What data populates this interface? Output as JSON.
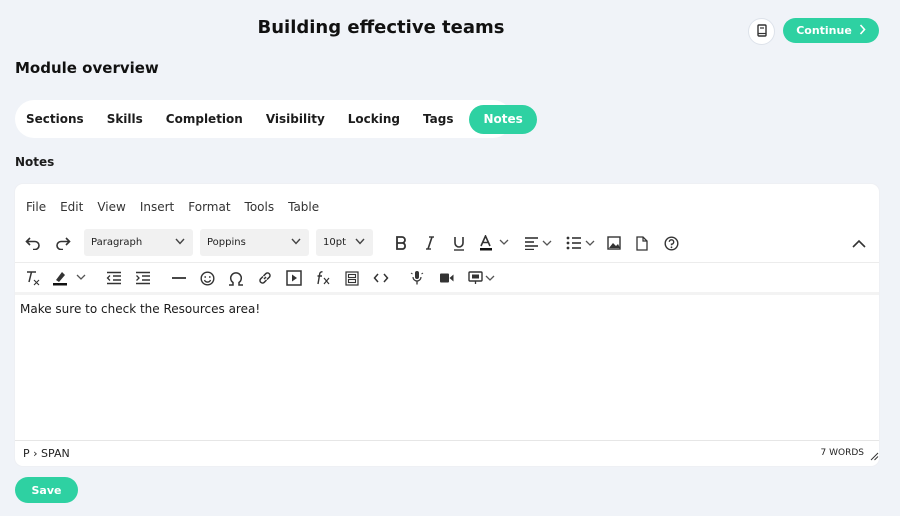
{
  "header": {
    "title": "Building effective teams",
    "book_icon": "book-icon",
    "continue_label": "Continue"
  },
  "module": {
    "title": "Module overview"
  },
  "tabs": [
    {
      "label": "Sections",
      "active": false
    },
    {
      "label": "Skills",
      "active": false
    },
    {
      "label": "Completion",
      "active": false
    },
    {
      "label": "Visibility",
      "active": false
    },
    {
      "label": "Locking",
      "active": false
    },
    {
      "label": "Tags",
      "active": false
    },
    {
      "label": "Notes",
      "active": true
    }
  ],
  "notes_label": "Notes",
  "editor": {
    "menu": [
      "File",
      "Edit",
      "View",
      "Insert",
      "Format",
      "Tools",
      "Table"
    ],
    "block_format": "Paragraph",
    "font_family": "Poppins",
    "font_size": "10pt",
    "content": "Make sure to check the Resources area!",
    "status_path": "P › SPAN",
    "word_count": "7 WORDS"
  },
  "save_label": "Save",
  "colors": {
    "accent": "#2ed1a2",
    "background": "#f0f3f8"
  }
}
